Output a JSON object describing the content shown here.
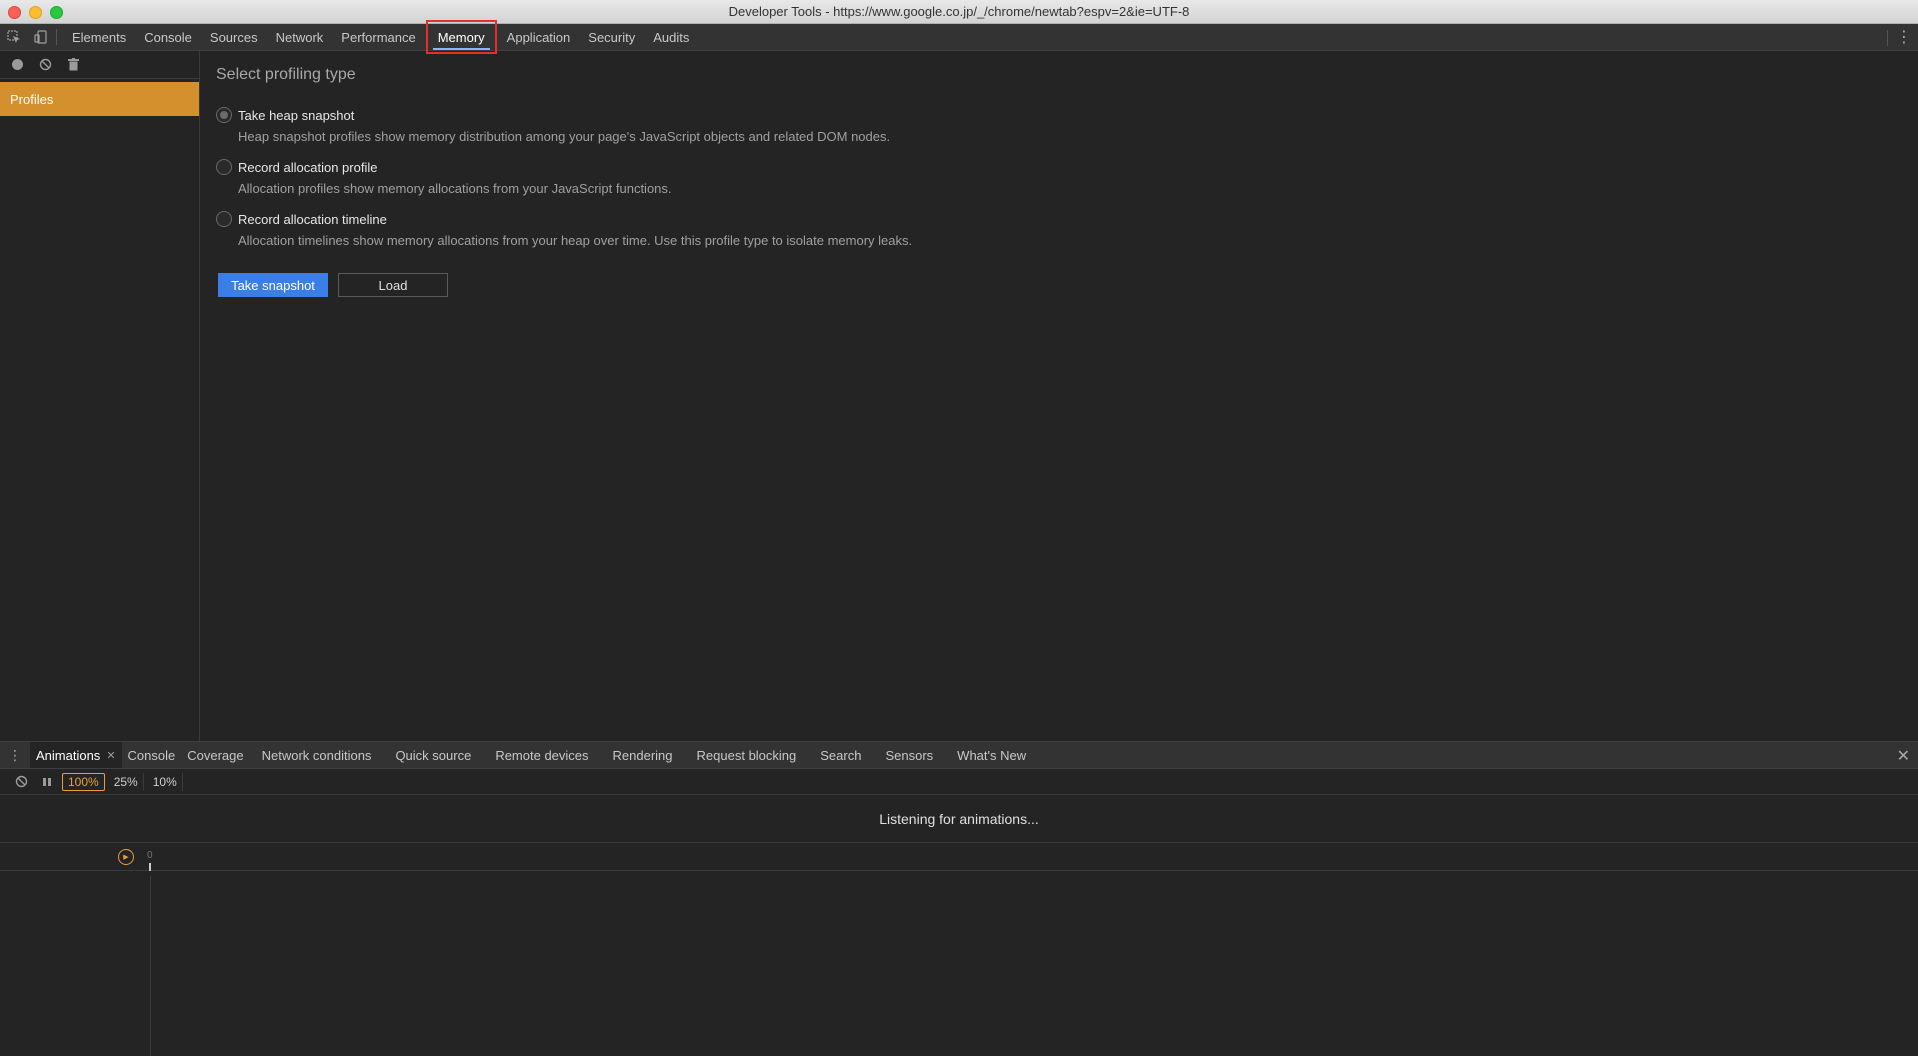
{
  "window": {
    "title": "Developer Tools - https://www.google.co.jp/_/chrome/newtab?espv=2&ie=UTF-8"
  },
  "icons": {
    "inspect": "inspect-element-icon",
    "device": "device-toolbar-icon",
    "more": "more-vertical-icon",
    "record": "record-icon",
    "clear": "clear-icon",
    "trash": "trash-icon",
    "pause": "pause-icon",
    "close": "close-icon",
    "replay": "replay-icon"
  },
  "main_tabs": [
    {
      "label": "Elements"
    },
    {
      "label": "Console"
    },
    {
      "label": "Sources"
    },
    {
      "label": "Network"
    },
    {
      "label": "Performance"
    },
    {
      "label": "Memory"
    },
    {
      "label": "Application"
    },
    {
      "label": "Security"
    },
    {
      "label": "Audits"
    }
  ],
  "active_tab": "Memory",
  "sidebar": {
    "profiles_label": "Profiles"
  },
  "memory": {
    "heading": "Select profiling type",
    "options": [
      {
        "label": "Take heap snapshot",
        "description": "Heap snapshot profiles show memory distribution among your page's JavaScript objects and related DOM nodes.",
        "checked": true
      },
      {
        "label": "Record allocation profile",
        "description": "Allocation profiles show memory allocations from your JavaScript functions.",
        "checked": false
      },
      {
        "label": "Record allocation timeline",
        "description": "Allocation timelines show memory allocations from your heap over time. Use this profile type to isolate memory leaks.",
        "checked": false
      }
    ],
    "primary_button": "Take snapshot",
    "secondary_button": "Load"
  },
  "drawer": {
    "tabs": [
      {
        "label": "Animations"
      },
      {
        "label": "Console"
      },
      {
        "label": "Coverage"
      },
      {
        "label": "Network conditions"
      },
      {
        "label": "Quick source"
      },
      {
        "label": "Remote devices"
      },
      {
        "label": "Rendering"
      },
      {
        "label": "Request blocking"
      },
      {
        "label": "Search"
      },
      {
        "label": "Sensors"
      },
      {
        "label": "What's New"
      }
    ],
    "speeds": [
      "100%",
      "25%",
      "10%"
    ],
    "active_speed": "100%",
    "status": "Listening for animations...",
    "timeline_zero": "0"
  },
  "colors": {
    "accent_orange": "#d4902c",
    "primary_blue": "#3b7fe6",
    "highlight_red": "#e0312b"
  }
}
